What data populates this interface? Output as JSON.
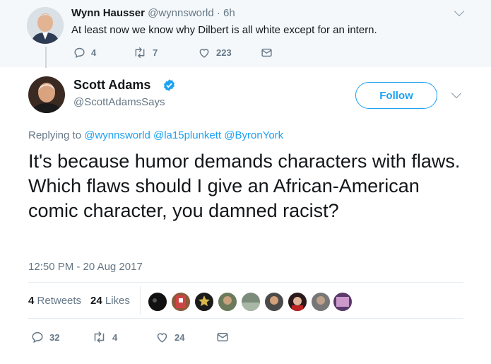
{
  "reply": {
    "name": "Wynn Hausser",
    "handle": "@wynnsworld",
    "dot": "·",
    "time": "6h",
    "text": "At least now we know why Dilbert is all white except for an intern.",
    "replies": "4",
    "retweets": "7",
    "likes": "223"
  },
  "tweet": {
    "name": "Scott Adams",
    "handle": "@ScottAdamsSays",
    "follow_label": "Follow",
    "replying_prefix": "Replying to",
    "replying_to": [
      "@wynnsworld",
      "@la15plunkett",
      "@ByronYork"
    ],
    "text": "It's because humor demands characters with flaws. Which flaws should I give an African-American comic character, you damned racist?",
    "timestamp": "12:50 PM - 20 Aug 2017",
    "retweets_count": "4",
    "retweets_label": "Retweets",
    "likes_count": "24",
    "likes_label": "Likes",
    "replies": "32",
    "retweets": "4",
    "likes": "24"
  },
  "icons": {
    "reply": "reply-icon",
    "retweet": "retweet-icon",
    "like": "heart-icon",
    "message": "envelope-icon",
    "verified": "verified-badge-icon",
    "menu": "chevron-down-icon"
  },
  "colors": {
    "brand": "#1da1f2",
    "muted": "#657786",
    "text": "#14171a",
    "reply_bg": "#f5f8fa",
    "divider": "#e6ecf0"
  }
}
